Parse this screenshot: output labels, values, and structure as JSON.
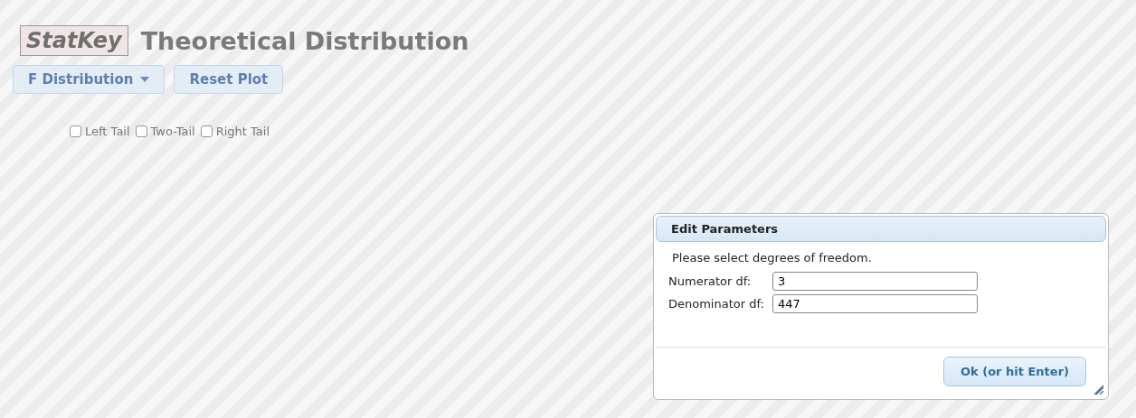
{
  "header": {
    "logo": "StatKey",
    "title": "Theoretical Distribution"
  },
  "toolbar": {
    "distribution_menu": "F Distribution",
    "reset_button": "Reset Plot"
  },
  "tails": [
    {
      "label": "Left Tail",
      "checked": false
    },
    {
      "label": "Two-Tail",
      "checked": false
    },
    {
      "label": "Right Tail",
      "checked": false
    }
  ],
  "dialog": {
    "title": "Edit Parameters",
    "prompt": "Please select degrees of freedom.",
    "fields": [
      {
        "label": "Numerator df:",
        "value": "3"
      },
      {
        "label": "Denominator df:",
        "value": "447"
      }
    ],
    "ok_button": "Ok (or hit Enter)"
  }
}
